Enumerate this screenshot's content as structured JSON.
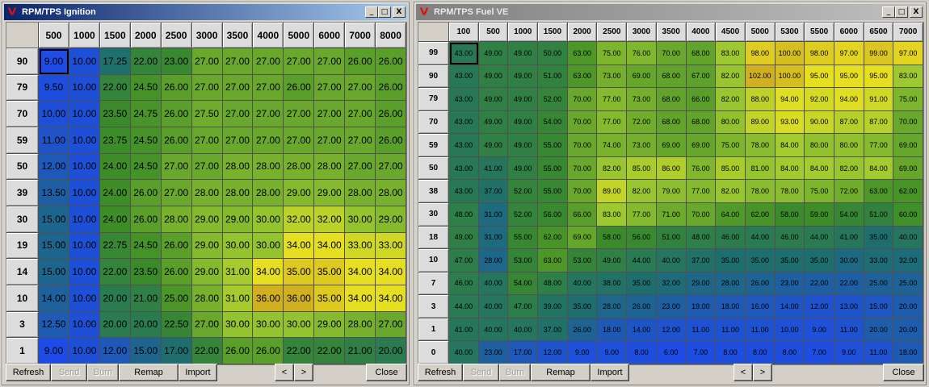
{
  "ignition": {
    "title": "RPM/TPS Ignition",
    "rpm": [
      "500",
      "1000",
      "1500",
      "2000",
      "2500",
      "3000",
      "3500",
      "4000",
      "5000",
      "6000",
      "7000",
      "8000"
    ],
    "tps": [
      "90",
      "79",
      "70",
      "59",
      "50",
      "39",
      "30",
      "19",
      "14",
      "10",
      "3",
      "1"
    ],
    "values": [
      [
        "9.00",
        "10.00",
        "17.25",
        "22.00",
        "23.00",
        "27.00",
        "27.00",
        "27.00",
        "27.00",
        "27.00",
        "26.00",
        "26.00"
      ],
      [
        "9.50",
        "10.00",
        "22.00",
        "24.50",
        "26.00",
        "27.00",
        "27.00",
        "27.00",
        "26.00",
        "27.00",
        "27.00",
        "26.00"
      ],
      [
        "10.00",
        "10.00",
        "23.50",
        "24.75",
        "26.00",
        "27.50",
        "27.00",
        "27.00",
        "27.00",
        "27.00",
        "27.00",
        "26.00"
      ],
      [
        "11.00",
        "10.00",
        "23.75",
        "24.50",
        "26.00",
        "27.00",
        "27.00",
        "27.00",
        "27.00",
        "27.00",
        "27.00",
        "26.00"
      ],
      [
        "12.00",
        "10.00",
        "24.00",
        "24.50",
        "27.00",
        "27.00",
        "28.00",
        "28.00",
        "28.00",
        "28.00",
        "27.00",
        "27.00"
      ],
      [
        "13.50",
        "10.00",
        "24.00",
        "26.00",
        "27.00",
        "28.00",
        "28.00",
        "28.00",
        "29.00",
        "29.00",
        "28.00",
        "28.00"
      ],
      [
        "15.00",
        "10.00",
        "24.00",
        "26.00",
        "28.00",
        "29.00",
        "29.00",
        "30.00",
        "32.00",
        "32.00",
        "30.00",
        "29.00"
      ],
      [
        "15.00",
        "10.00",
        "22.75",
        "24.50",
        "26.00",
        "29.00",
        "30.00",
        "30.00",
        "34.00",
        "34.00",
        "33.00",
        "33.00"
      ],
      [
        "15.00",
        "10.00",
        "22.00",
        "23.50",
        "26.00",
        "29.00",
        "31.00",
        "34.00",
        "35.00",
        "35.00",
        "34.00",
        "34.00"
      ],
      [
        "14.00",
        "10.00",
        "20.00",
        "21.00",
        "25.00",
        "28.00",
        "31.00",
        "36.00",
        "36.00",
        "35.00",
        "34.00",
        "34.00"
      ],
      [
        "12.50",
        "10.00",
        "20.00",
        "20.00",
        "22.50",
        "27.00",
        "30.00",
        "30.00",
        "30.00",
        "29.00",
        "28.00",
        "27.00"
      ],
      [
        "9.00",
        "10.00",
        "12.00",
        "15.00",
        "17.00",
        "22.00",
        "26.00",
        "26.00",
        "22.00",
        "22.00",
        "21.00",
        "20.00"
      ]
    ],
    "buttons": {
      "refresh": "Refresh",
      "send": "Send",
      "burn": "Burn",
      "remap": "Remap",
      "import": "Import",
      "prev": "<",
      "next": ">",
      "close": "Close"
    }
  },
  "fuel": {
    "title": "RPM/TPS Fuel VE",
    "rpm": [
      "100",
      "500",
      "1000",
      "1500",
      "2000",
      "2500",
      "3000",
      "3500",
      "4000",
      "4500",
      "5000",
      "5300",
      "5500",
      "6000",
      "6500",
      "7000"
    ],
    "tps": [
      "99",
      "90",
      "79",
      "70",
      "59",
      "50",
      "38",
      "30",
      "18",
      "10",
      "7",
      "3",
      "1",
      "0"
    ],
    "values": [
      [
        "43.00",
        "49.00",
        "49.00",
        "50.00",
        "63.00",
        "75.00",
        "76.00",
        "70.00",
        "68.00",
        "83.00",
        "98.00",
        "100.00",
        "98.00",
        "97.00",
        "99.00",
        "97.00"
      ],
      [
        "43.00",
        "49.00",
        "49.00",
        "51.00",
        "63.00",
        "73.00",
        "69.00",
        "68.00",
        "67.00",
        "82.00",
        "102.00",
        "100.00",
        "95.00",
        "95.00",
        "95.00",
        "83.00"
      ],
      [
        "43.00",
        "49.00",
        "49.00",
        "52.00",
        "70.00",
        "77.00",
        "73.00",
        "68.00",
        "66.00",
        "82.00",
        "88.00",
        "94.00",
        "92.00",
        "94.00",
        "91.00",
        "75.00"
      ],
      [
        "43.00",
        "49.00",
        "49.00",
        "54.00",
        "70.00",
        "77.00",
        "72.00",
        "68.00",
        "68.00",
        "80.00",
        "89.00",
        "93.00",
        "90.00",
        "87.00",
        "87.00",
        "70.00"
      ],
      [
        "43.00",
        "49.00",
        "49.00",
        "55.00",
        "70.00",
        "74.00",
        "73.00",
        "69.00",
        "69.00",
        "75.00",
        "78.00",
        "84.00",
        "80.00",
        "80.00",
        "77.00",
        "69.00"
      ],
      [
        "43.00",
        "41.00",
        "49.00",
        "55.00",
        "70.00",
        "82.00",
        "85.00",
        "86.00",
        "76.00",
        "85.00",
        "81.00",
        "84.00",
        "84.00",
        "82.00",
        "84.00",
        "69.00"
      ],
      [
        "43.00",
        "37.00",
        "52.00",
        "55.00",
        "70.00",
        "89.00",
        "82.00",
        "79.00",
        "77.00",
        "82.00",
        "78.00",
        "78.00",
        "75.00",
        "72.00",
        "63.00",
        "62.00"
      ],
      [
        "48.00",
        "31.00",
        "52.00",
        "56.00",
        "66.00",
        "83.00",
        "77.00",
        "71.00",
        "70.00",
        "64.00",
        "62.00",
        "58.00",
        "59.00",
        "54.00",
        "51.00",
        "60.00"
      ],
      [
        "49.00",
        "31.00",
        "55.00",
        "62.00",
        "69.00",
        "58.00",
        "56.00",
        "51.00",
        "48.00",
        "46.00",
        "44.00",
        "46.00",
        "44.00",
        "41.00",
        "35.00",
        "40.00"
      ],
      [
        "47.00",
        "28.00",
        "53.00",
        "63.00",
        "53.00",
        "49.00",
        "44.00",
        "40.00",
        "37.00",
        "35.00",
        "35.00",
        "35.00",
        "35.00",
        "30.00",
        "33.00",
        "32.00"
      ],
      [
        "46.00",
        "40.00",
        "54.00",
        "48.00",
        "40.00",
        "38.00",
        "35.00",
        "32.00",
        "29.00",
        "28.00",
        "26.00",
        "23.00",
        "22.00",
        "22.00",
        "25.00",
        "25.00"
      ],
      [
        "44.00",
        "40.00",
        "47.00",
        "39.00",
        "35.00",
        "28.00",
        "26.00",
        "23.00",
        "19.00",
        "18.00",
        "16.00",
        "14.00",
        "12.00",
        "13.00",
        "15.00",
        "20.00"
      ],
      [
        "41.00",
        "40.00",
        "40.00",
        "37.00",
        "26.00",
        "18.00",
        "14.00",
        "12.00",
        "11.00",
        "11.00",
        "11.00",
        "10.00",
        "9.00",
        "11.00",
        "20.00",
        "20.00"
      ],
      [
        "40.00",
        "23.00",
        "17.00",
        "12.00",
        "9.00",
        "9.00",
        "8.00",
        "6.00",
        "7.00",
        "8.00",
        "8.00",
        "8.00",
        "7.00",
        "9.00",
        "11.00",
        "18.00"
      ]
    ],
    "buttons": {
      "refresh": "Refresh",
      "send": "Send",
      "burn": "Burn",
      "remap": "Remap",
      "import": "Import",
      "prev": "<",
      "next": ">",
      "close": "Close"
    }
  },
  "window_controls": {
    "minimize": "_",
    "maximize": "□",
    "close": "X"
  },
  "logo_letter": "V",
  "colors": {
    "low": "#1e4ce6",
    "mid_low": "#1e6e6e",
    "mid": "#3c8c28",
    "mid_high": "#9cc830",
    "high": "#e8e020",
    "peak": "#d0b020",
    "selected_border": "#000000"
  }
}
